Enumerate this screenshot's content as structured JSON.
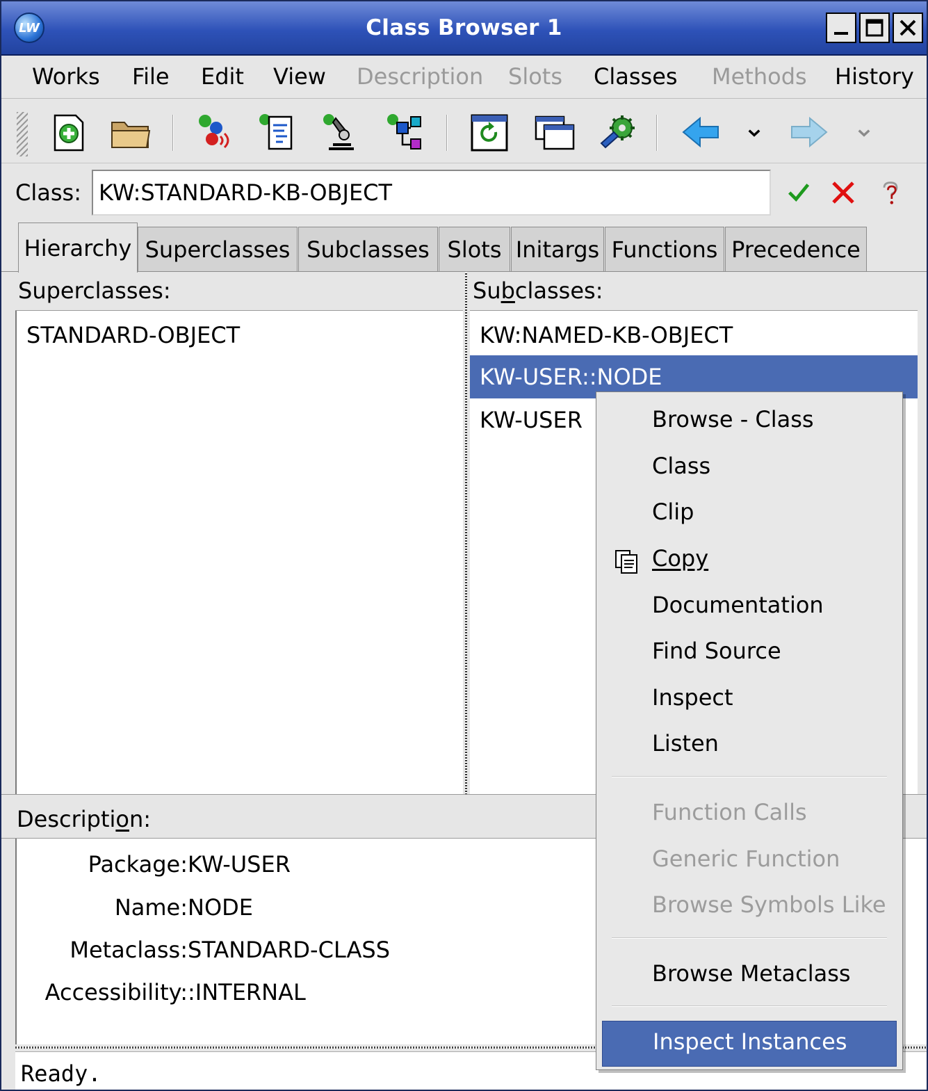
{
  "window": {
    "title": "Class Browser 1",
    "app_icon": "LW"
  },
  "menubar": {
    "items": [
      {
        "label": "Works",
        "disabled": false
      },
      {
        "label": "File",
        "disabled": false
      },
      {
        "label": "Edit",
        "disabled": false
      },
      {
        "label": "View",
        "disabled": false
      },
      {
        "label": "Description",
        "disabled": true
      },
      {
        "label": "Slots",
        "disabled": true
      },
      {
        "label": "Classes",
        "disabled": false
      },
      {
        "label": "Methods",
        "disabled": true
      },
      {
        "label": "History",
        "disabled": false
      }
    ]
  },
  "toolbar": {
    "icons": [
      "new-document-icon",
      "open-folder-icon",
      "listener-icon",
      "clipboard-icon",
      "inspector-icon",
      "class-graph-icon",
      "refresh-window-icon",
      "window-icon",
      "settings-gear-icon",
      "back-arrow-icon",
      "forward-arrow-icon"
    ]
  },
  "class_row": {
    "label": "Class:",
    "value": "KW:STANDARD-KB-OBJECT"
  },
  "tabs": [
    {
      "label": "Hierarchy",
      "active": true
    },
    {
      "label": "Superclasses",
      "active": false
    },
    {
      "label": "Subclasses",
      "active": false
    },
    {
      "label": "Slots",
      "active": false
    },
    {
      "label": "Initargs",
      "active": false
    },
    {
      "label": "Functions",
      "active": false
    },
    {
      "label": "Precedence",
      "active": false
    }
  ],
  "superclasses": {
    "header": "Superclasses:",
    "items": [
      "STANDARD-OBJECT"
    ]
  },
  "subclasses": {
    "header": "Subclasses:",
    "items": [
      "KW:NAMED-KB-OBJECT",
      "KW-USER::NODE",
      "KW-USER"
    ],
    "selected_index": 1
  },
  "description": {
    "header": "Description:",
    "fields": [
      {
        "label": "Package:",
        "value": "KW-USER"
      },
      {
        "label": "Name:",
        "value": "NODE"
      },
      {
        "label": "Metaclass:",
        "value": "STANDARD-CLASS"
      },
      {
        "label": "Accessibility:",
        "value": ":INTERNAL"
      }
    ]
  },
  "status": {
    "text": "Ready."
  },
  "context_menu": {
    "items": [
      {
        "label": "Browse - Class",
        "disabled": false
      },
      {
        "label": "Class",
        "disabled": false
      },
      {
        "label": "Clip",
        "disabled": false
      },
      {
        "label": "Copy",
        "disabled": false,
        "icon": "copy-icon"
      },
      {
        "label": "Documentation",
        "disabled": false
      },
      {
        "label": "Find Source",
        "disabled": false
      },
      {
        "label": "Inspect",
        "disabled": false
      },
      {
        "label": "Listen",
        "disabled": false
      },
      {
        "label": "Function Calls",
        "disabled": true
      },
      {
        "label": "Generic Function",
        "disabled": true
      },
      {
        "label": "Browse Symbols Like",
        "disabled": true
      },
      {
        "label": "Browse Metaclass",
        "disabled": false
      },
      {
        "label": "Inspect Instances",
        "disabled": false,
        "highlighted": true
      }
    ]
  },
  "colors": {
    "titlebar": "#2e52b8",
    "selection": "#4a6bb3",
    "background": "#e6e6e6"
  }
}
